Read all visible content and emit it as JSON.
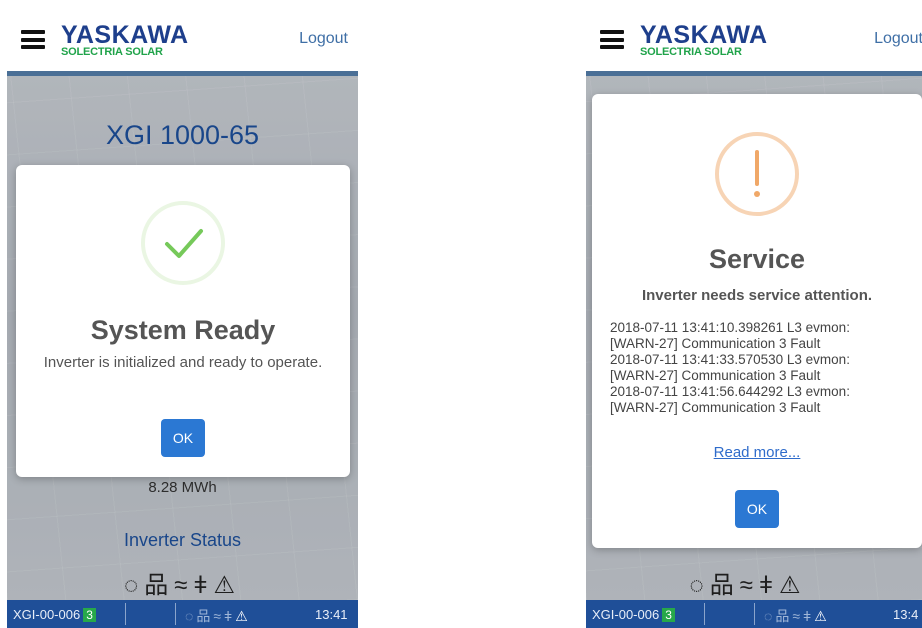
{
  "brand": {
    "top": "YASKAWA",
    "bottom": "SOLECTRIA SOLAR"
  },
  "header": {
    "logout": "Logout"
  },
  "dashboard": {
    "model": "XGI 1000-65",
    "energy": "8.28 MWh",
    "inverter_status_title": "Inverter Status",
    "status_icons": [
      "power-icon",
      "network-icon",
      "grid-wave-icon",
      "wrench-icon",
      "warning-icon"
    ]
  },
  "status_bar": {
    "device_id": "XGI-00-006",
    "count": "3",
    "time_left": "13:41",
    "time_right": "13:4"
  },
  "modal_ready": {
    "title": "System Ready",
    "message": "Inverter is initialized and ready to operate.",
    "ok": "OK",
    "icon": "checkmark-icon",
    "accent": "#76c95a"
  },
  "modal_service": {
    "title": "Service",
    "subtitle": "Inverter needs service attention.",
    "log": [
      "2018-07-11 13:41:10.398261 L3 evmon:",
      "[WARN-27] Communication 3 Fault",
      "2018-07-11 13:41:33.570530 L3 evmon:",
      "[WARN-27] Communication 3 Fault",
      "2018-07-11 13:41:56.644292 L3 evmon:",
      "[WARN-27] Communication 3 Fault"
    ],
    "read_more": "Read more...",
    "ok": "OK",
    "icon": "exclamation-icon",
    "accent": "#f0a868"
  },
  "colors": {
    "brand_blue": "#1e3f8c",
    "brand_green": "#20a34a",
    "status_bar": "#1f4f98",
    "ok_button": "#2b78d3"
  }
}
